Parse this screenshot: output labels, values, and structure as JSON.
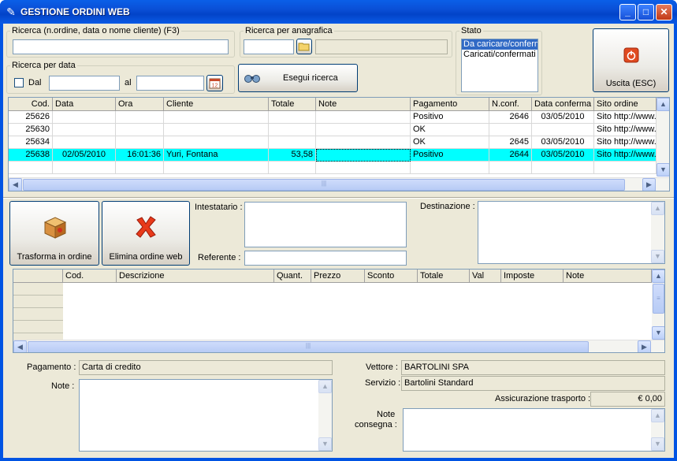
{
  "window": {
    "title": "GESTIONE ORDINI WEB",
    "buttons": {
      "minimize": "_",
      "maximize": "□",
      "close": "✕"
    }
  },
  "search": {
    "order_legend": "Ricerca (n.ordine, data o nome cliente) (F3)",
    "order_value": "",
    "registry_legend": "Ricerca per anagrafica",
    "registry_code": "",
    "registry_name": "",
    "date_legend": "Ricerca per data",
    "date_checkbox": "Dal",
    "date_from": "",
    "date_to_label": "al",
    "date_to": "",
    "search_button": "Esegui ricerca"
  },
  "status": {
    "legend": "Stato",
    "options": [
      "Da caricare/confermare",
      "Caricati/confermati"
    ],
    "selected_index": 0
  },
  "exit_button": "Uscita (ESC)",
  "orders_table": {
    "columns": [
      "Cod.",
      "Data",
      "Ora",
      "Cliente",
      "Totale",
      "Note",
      "Pagamento",
      "N.conf.",
      "Data conferma",
      "Sito ordine"
    ],
    "rows": [
      {
        "cod": "25626",
        "data": "",
        "ora": "",
        "cliente": "",
        "totale": "",
        "note": "",
        "pagamento": "Positivo",
        "nconf": "2646",
        "data_conferma": "03/05/2010",
        "sito": "Sito http://www.",
        "selected": false
      },
      {
        "cod": "25630",
        "data": "",
        "ora": "",
        "cliente": "",
        "totale": "",
        "note": "",
        "pagamento": "OK",
        "nconf": "",
        "data_conferma": "",
        "sito": "Sito http://www.",
        "selected": false
      },
      {
        "cod": "25634",
        "data": "",
        "ora": "",
        "cliente": "",
        "totale": "",
        "note": "",
        "pagamento": "OK",
        "nconf": "2645",
        "data_conferma": "03/05/2010",
        "sito": "Sito http://www.",
        "selected": false
      },
      {
        "cod": "25638",
        "data": "02/05/2010",
        "ora": "16:01:36",
        "cliente": "Yuri, Fontana",
        "totale": "53,58",
        "note": "",
        "pagamento": "Positivo",
        "nconf": "2644",
        "data_conferma": "03/05/2010",
        "sito": "Sito http://www.",
        "selected": true
      }
    ]
  },
  "actions": {
    "transform": "Trasforma in ordine",
    "delete": "Elimina ordine web"
  },
  "details": {
    "holder_label": "Intestatario :",
    "holder_value": "",
    "referent_label": "Referente :",
    "referent_value": "",
    "destination_label": "Destinazione :",
    "destination_value": ""
  },
  "lines_table": {
    "columns": [
      "Cod.",
      "Descrizione",
      "Quant.",
      "Prezzo",
      "Sconto",
      "Totale",
      "Val",
      "Imposte",
      "Note"
    ]
  },
  "footer": {
    "payment_label": "Pagamento :",
    "payment_value": "Carta di credito",
    "notes_label": "Note :",
    "notes_value": "",
    "carrier_label": "Vettore :",
    "carrier_value": "BARTOLINI SPA",
    "service_label": "Servizio :",
    "service_value": "Bartolini Standard",
    "insurance_label": "Assicurazione trasporto :",
    "insurance_value": "€ 0,00",
    "delivery_notes_label_1": "Note",
    "delivery_notes_label_2": "consegna :",
    "delivery_notes_value": ""
  },
  "colors": {
    "selection_row": "#00ffff",
    "title_bar": "#0054e3",
    "face": "#ece9d8"
  },
  "icons": [
    "app-icon",
    "folder-icon",
    "calendar-icon",
    "binoculars-icon",
    "power-icon",
    "package-icon",
    "red-x-icon"
  ]
}
